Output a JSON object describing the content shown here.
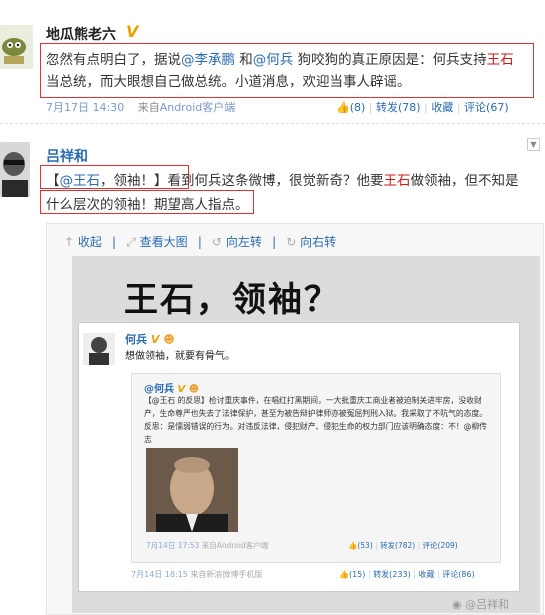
{
  "post1": {
    "author": "地瓜熊老六",
    "badge": "V",
    "text_a": "忽然有点明白了，据说",
    "mention_1": "@李承鹏",
    "text_b": " 和",
    "mention_2": "@何兵",
    "text_c": " 狗咬狗的真正原因是：何兵支持",
    "red_1": "王石",
    "text_d": "当总统，而大眼想自己做总统。小道消息，欢迎当事人辟谣。",
    "time": "7月17日 14:30",
    "source_prefix": "来自",
    "source": "Android客户端",
    "like_count": "(8)",
    "repost": "转发(78)",
    "fav": "收藏",
    "comment": "评论(67)"
  },
  "post2": {
    "author": "吕祥和",
    "text_open": "【",
    "mention": "@王石",
    "text_a": "，领袖！】看到何兵这条微博，很觉新奇？他要",
    "red": "王石",
    "text_b": "做领袖，但不知是",
    "text_c": "什么层次的领袖！期望高人指点。",
    "toolbar": {
      "collapse": "收起",
      "view_large": "查看大图",
      "rotate_left": "向左转",
      "rotate_right": "向右转"
    }
  },
  "image": {
    "title": "王石，领袖？",
    "inner_author": "何兵",
    "inner_text": "想做领袖，就要有骨气。",
    "quoted_author": "@何兵",
    "quoted_text": "【@王石 的反思】检讨重庆事件，在唱红打黑期间，一大批重庆工商业者被迫制关进牢房，没收财产，生命尊严也失去了法律保护，甚至为被告辩护律师亦被冤屈判刑入狱。我采取了不吭气的态度。反思：是懦弱错误的行为。对违反法律，侵犯财产、侵犯生命的权力部门应该明确态度：不！@柳传志",
    "quoted_time": "7月14日 17:53",
    "quoted_source": "来自Android客户端",
    "quoted_like": "(53)",
    "quoted_repost": "转发(782)",
    "quoted_comment": "评论(209)",
    "bottom_time": "7月14日 18:15",
    "bottom_source": "来自新浪微博手机版",
    "bottom_like": "(15)",
    "bottom_repost": "转发(233)",
    "bottom_fav": "收藏",
    "bottom_comment": "评论(86)",
    "watermark": "@吕祥和"
  }
}
